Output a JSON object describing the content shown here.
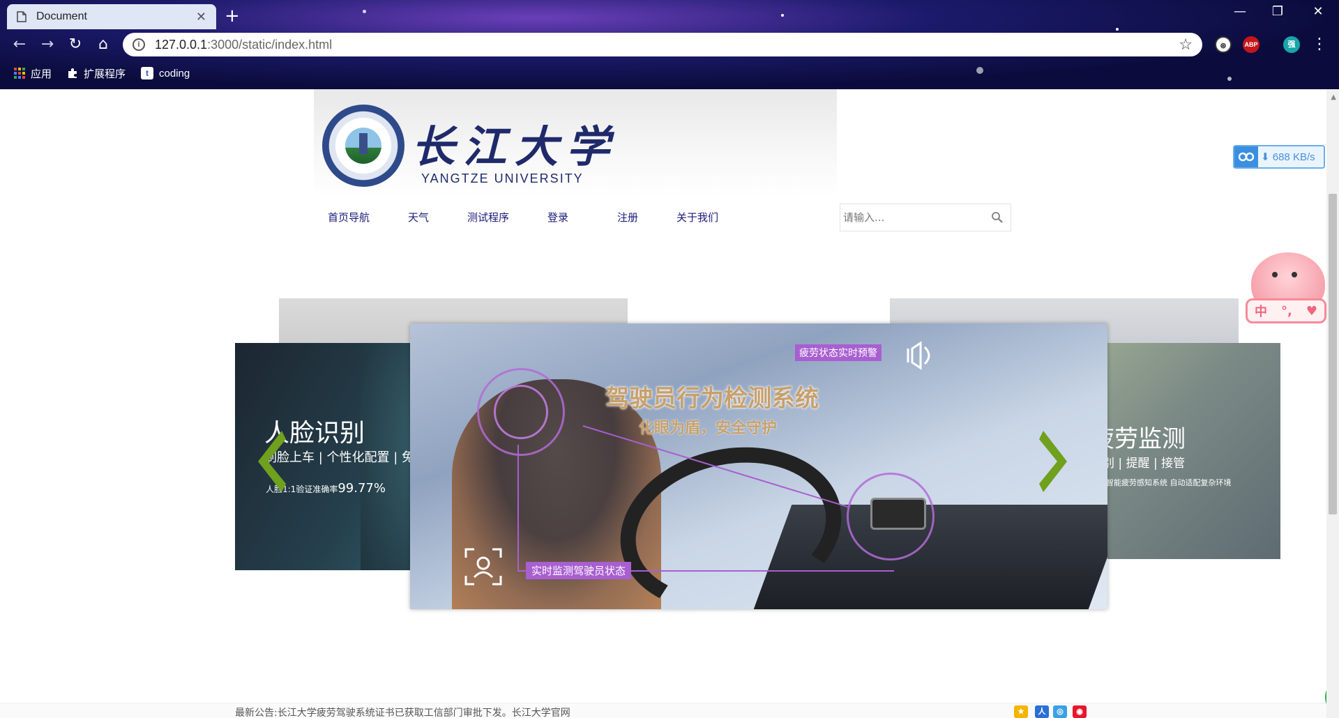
{
  "browser": {
    "tab_title": "Document",
    "url_host": "127.0.0.1",
    "url_path": ":3000/static/index.html",
    "bookmarks": [
      {
        "label": "应用",
        "icon": "apps-grid-icon"
      },
      {
        "label": "扩展程序",
        "icon": "puzzle-icon"
      },
      {
        "label": "coding",
        "icon": "coding-icon"
      }
    ],
    "extensions": [
      "abp-icon",
      "profile-avatar"
    ],
    "profile_initial": "强",
    "abp_label": "ABP"
  },
  "header": {
    "logo_cn": "长江大学",
    "logo_en": "YANGTZE UNIVERSITY"
  },
  "nav": {
    "items": [
      "首页导航",
      "天气",
      "测试程序",
      "登录",
      "注册",
      "关于我们"
    ]
  },
  "search": {
    "placeholder": "请输入..."
  },
  "speed_badge": "688 KB/s",
  "ime": {
    "label": "中"
  },
  "carousel": {
    "left": {
      "title": "人脸识别",
      "subtitle": "刷脸上车 | 个性化配置 | 免",
      "stat_label": "人脸1:1验证准确率",
      "stat_value": "99.77%"
    },
    "center": {
      "title": "驾驶员行为检测系统",
      "tagline": "化眼为盾，安全守护",
      "alert_label": "疲劳状态实时预警",
      "monitor_label": "实时监测驾驶员状态"
    },
    "right": {
      "title": "疲劳监测",
      "subtitle": "识别 | 提醒 | 接管",
      "desc": "人工智能疲劳感知系统  自动适配复杂环境"
    }
  },
  "footer": {
    "notice": "最新公告:长江大学疲劳驾驶系统证书已获取工信部门审批下发。长江大学官网"
  },
  "colors": {
    "nav_text": "#1a1a7a",
    "accent_purple": "#a85fd0",
    "arrow_green": "#6fa01e"
  }
}
